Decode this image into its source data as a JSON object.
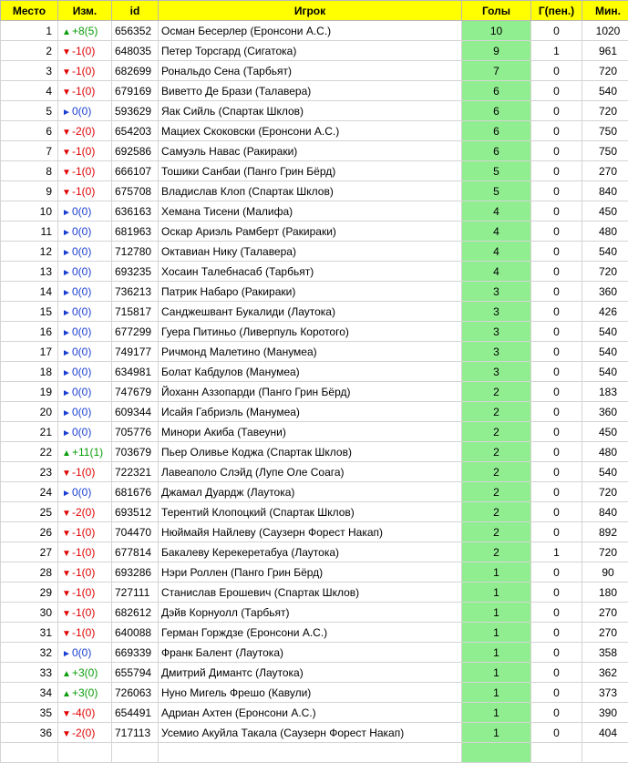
{
  "headers": {
    "place": "Место",
    "change": "Изм.",
    "id": "id",
    "player": "Игрок",
    "goals": "Голы",
    "pen": "Г(пен.)",
    "mins": "Мин."
  },
  "colors": {
    "header_bg": "#ffff00",
    "goals_bg": "#90ee90",
    "up": "#0a9c0a",
    "down": "#e00000",
    "same": "#1a3fd0"
  },
  "rows": [
    {
      "place": "1",
      "dir": "up",
      "change": "+8(5)",
      "id": "656352",
      "player": "Осман Бесерлер (Еронсони А.С.)",
      "goals": "10",
      "pen": "0",
      "mins": "1020"
    },
    {
      "place": "2",
      "dir": "down",
      "change": "-1(0)",
      "id": "648035",
      "player": "Петер Торсгард (Сигатока)",
      "goals": "9",
      "pen": "1",
      "mins": "961"
    },
    {
      "place": "3",
      "dir": "down",
      "change": "-1(0)",
      "id": "682699",
      "player": "Рональдо Сена (Тарбьят)",
      "goals": "7",
      "pen": "0",
      "mins": "720"
    },
    {
      "place": "4",
      "dir": "down",
      "change": "-1(0)",
      "id": "679169",
      "player": "Виветто Де Брази (Талавера)",
      "goals": "6",
      "pen": "0",
      "mins": "540"
    },
    {
      "place": "5",
      "dir": "same",
      "change": "0(0)",
      "id": "593629",
      "player": "Яак Сийль (Спартак Шклов)",
      "goals": "6",
      "pen": "0",
      "mins": "720"
    },
    {
      "place": "6",
      "dir": "down",
      "change": "-2(0)",
      "id": "654203",
      "player": "Мациех Скоковски (Еронсони А.С.)",
      "goals": "6",
      "pen": "0",
      "mins": "750"
    },
    {
      "place": "7",
      "dir": "down",
      "change": "-1(0)",
      "id": "692586",
      "player": "Самуэль Навас (Ракираки)",
      "goals": "6",
      "pen": "0",
      "mins": "750"
    },
    {
      "place": "8",
      "dir": "down",
      "change": "-1(0)",
      "id": "666107",
      "player": "Тошики Санбаи (Панго Грин Бёрд)",
      "goals": "5",
      "pen": "0",
      "mins": "270"
    },
    {
      "place": "9",
      "dir": "down",
      "change": "-1(0)",
      "id": "675708",
      "player": "Владислав Клоп (Спартак Шклов)",
      "goals": "5",
      "pen": "0",
      "mins": "840"
    },
    {
      "place": "10",
      "dir": "same",
      "change": "0(0)",
      "id": "636163",
      "player": "Хемана Тисени (Малифа)",
      "goals": "4",
      "pen": "0",
      "mins": "450"
    },
    {
      "place": "11",
      "dir": "same",
      "change": "0(0)",
      "id": "681963",
      "player": "Оскар Ариэль Рамберт (Ракираки)",
      "goals": "4",
      "pen": "0",
      "mins": "480"
    },
    {
      "place": "12",
      "dir": "same",
      "change": "0(0)",
      "id": "712780",
      "player": "Октавиан Нику (Талавера)",
      "goals": "4",
      "pen": "0",
      "mins": "540"
    },
    {
      "place": "13",
      "dir": "same",
      "change": "0(0)",
      "id": "693235",
      "player": "Хосаин Талебнасаб (Тарбьят)",
      "goals": "4",
      "pen": "0",
      "mins": "720"
    },
    {
      "place": "14",
      "dir": "same",
      "change": "0(0)",
      "id": "736213",
      "player": "Патрик Набаро (Ракираки)",
      "goals": "3",
      "pen": "0",
      "mins": "360"
    },
    {
      "place": "15",
      "dir": "same",
      "change": "0(0)",
      "id": "715817",
      "player": "Санджешвант Букалиди (Лаутока)",
      "goals": "3",
      "pen": "0",
      "mins": "426"
    },
    {
      "place": "16",
      "dir": "same",
      "change": "0(0)",
      "id": "677299",
      "player": "Гуера Питиньо (Ливерпуль Коротого)",
      "goals": "3",
      "pen": "0",
      "mins": "540"
    },
    {
      "place": "17",
      "dir": "same",
      "change": "0(0)",
      "id": "749177",
      "player": "Ричмонд Малетино (Манумеа)",
      "goals": "3",
      "pen": "0",
      "mins": "540"
    },
    {
      "place": "18",
      "dir": "same",
      "change": "0(0)",
      "id": "634981",
      "player": "Болат Кабдулов (Манумеа)",
      "goals": "3",
      "pen": "0",
      "mins": "540"
    },
    {
      "place": "19",
      "dir": "same",
      "change": "0(0)",
      "id": "747679",
      "player": "Йоханн Аззопарди (Панго Грин Бёрд)",
      "goals": "2",
      "pen": "0",
      "mins": "183"
    },
    {
      "place": "20",
      "dir": "same",
      "change": "0(0)",
      "id": "609344",
      "player": "Исайя Габриэль (Манумеа)",
      "goals": "2",
      "pen": "0",
      "mins": "360"
    },
    {
      "place": "21",
      "dir": "same",
      "change": "0(0)",
      "id": "705776",
      "player": "Минори Акиба (Тавеуни)",
      "goals": "2",
      "pen": "0",
      "mins": "450"
    },
    {
      "place": "22",
      "dir": "up",
      "change": "+11(1)",
      "id": "703679",
      "player": "Пьер Оливье Коджа (Спартак Шклов)",
      "goals": "2",
      "pen": "0",
      "mins": "480"
    },
    {
      "place": "23",
      "dir": "down",
      "change": "-1(0)",
      "id": "722321",
      "player": "Лавеаполо Слэйд (Лупе Оле Соага)",
      "goals": "2",
      "pen": "0",
      "mins": "540"
    },
    {
      "place": "24",
      "dir": "same",
      "change": "0(0)",
      "id": "681676",
      "player": "Джамал Дуардж (Лаутока)",
      "goals": "2",
      "pen": "0",
      "mins": "720"
    },
    {
      "place": "25",
      "dir": "down",
      "change": "-2(0)",
      "id": "693512",
      "player": "Терентий Клопоцкий (Спартак Шклов)",
      "goals": "2",
      "pen": "0",
      "mins": "840"
    },
    {
      "place": "26",
      "dir": "down",
      "change": "-1(0)",
      "id": "704470",
      "player": "Нюймайя Найлеву (Саузерн Форест Накап)",
      "goals": "2",
      "pen": "0",
      "mins": "892"
    },
    {
      "place": "27",
      "dir": "down",
      "change": "-1(0)",
      "id": "677814",
      "player": "Бакалеву Керекеретабуа (Лаутока)",
      "goals": "2",
      "pen": "1",
      "mins": "720"
    },
    {
      "place": "28",
      "dir": "down",
      "change": "-1(0)",
      "id": "693286",
      "player": "Нэри Роллен (Панго Грин Бёрд)",
      "goals": "1",
      "pen": "0",
      "mins": "90"
    },
    {
      "place": "29",
      "dir": "down",
      "change": "-1(0)",
      "id": "727111",
      "player": "Станислав Ерошевич (Спартак Шклов)",
      "goals": "1",
      "pen": "0",
      "mins": "180"
    },
    {
      "place": "30",
      "dir": "down",
      "change": "-1(0)",
      "id": "682612",
      "player": "Дэйв Корнуолл (Тарбьят)",
      "goals": "1",
      "pen": "0",
      "mins": "270"
    },
    {
      "place": "31",
      "dir": "down",
      "change": "-1(0)",
      "id": "640088",
      "player": "Герман Горждзе (Еронсони А.С.)",
      "goals": "1",
      "pen": "0",
      "mins": "270"
    },
    {
      "place": "32",
      "dir": "same",
      "change": "0(0)",
      "id": "669339",
      "player": "Франк Балент (Лаутока)",
      "goals": "1",
      "pen": "0",
      "mins": "358"
    },
    {
      "place": "33",
      "dir": "up",
      "change": "+3(0)",
      "id": "655794",
      "player": "Дмитрий Димантс (Лаутока)",
      "goals": "1",
      "pen": "0",
      "mins": "362"
    },
    {
      "place": "34",
      "dir": "up",
      "change": "+3(0)",
      "id": "726063",
      "player": "Нуно Мигель Фрешо (Кавули)",
      "goals": "1",
      "pen": "0",
      "mins": "373"
    },
    {
      "place": "35",
      "dir": "down",
      "change": "-4(0)",
      "id": "654491",
      "player": "Адриан Ахтен (Еронсони А.С.)",
      "goals": "1",
      "pen": "0",
      "mins": "390"
    },
    {
      "place": "36",
      "dir": "down",
      "change": "-2(0)",
      "id": "717113",
      "player": "Усемио Акуйла Такала (Саузерн Форест Накап)",
      "goals": "1",
      "pen": "0",
      "mins": "404"
    },
    {
      "place": "",
      "dir": "",
      "change": "",
      "id": "",
      "player": "",
      "goals": "",
      "pen": "",
      "mins": ""
    }
  ]
}
